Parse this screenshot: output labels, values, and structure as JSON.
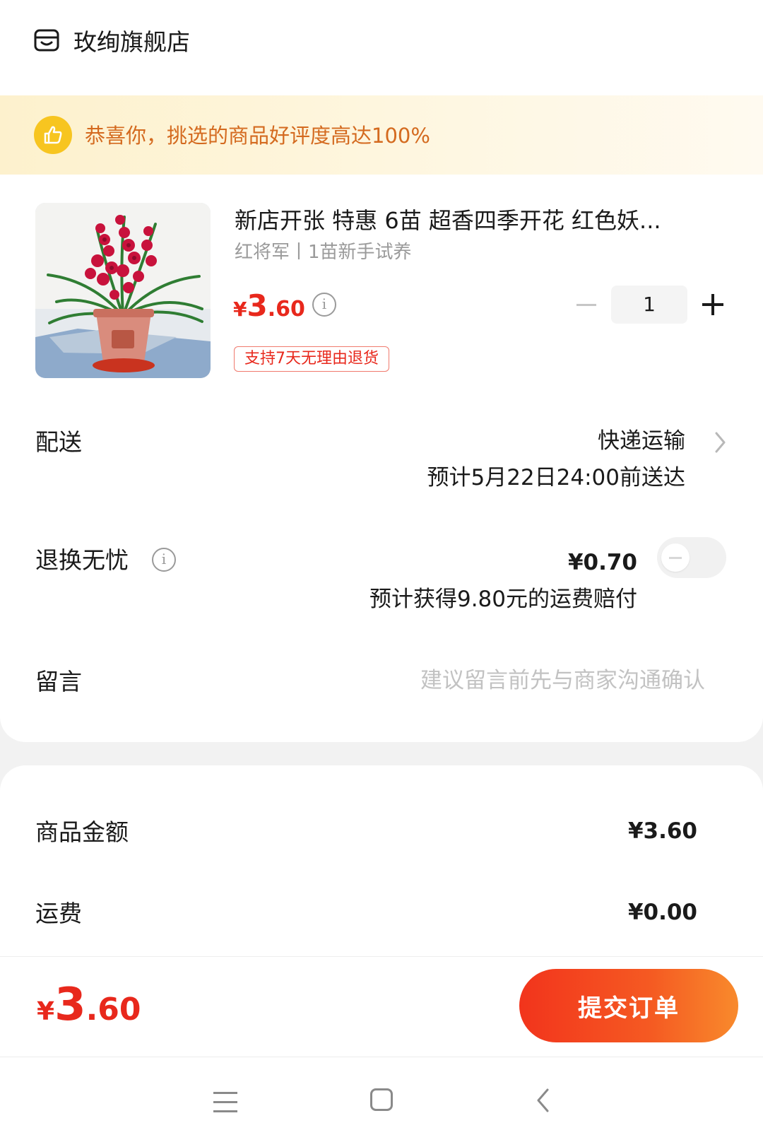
{
  "store": {
    "name": "玫绚旗舰店",
    "icon": "store-icon"
  },
  "banner": {
    "text": "恭喜你，挑选的商品好评度高达100%",
    "icon": "thumbs-up-icon"
  },
  "product": {
    "title": "新店开张 特惠 6苗 超香四季开花 红色妖...",
    "spec": "红将军丨1苗新手试养",
    "price_currency": "¥",
    "price_int": "3",
    "price_dec": ".60",
    "return_badge": "支持7天无理由退货",
    "quantity": "1"
  },
  "shipping": {
    "label": "配送",
    "method": "快递运输",
    "eta": "预计5月22日24:00前送达"
  },
  "worry_free": {
    "label": "退换无忧",
    "price": "¥0.70",
    "note": "预计获得9.80元的运费赔付",
    "enabled": false
  },
  "message": {
    "label": "留言",
    "placeholder": "建议留言前先与商家沟通确认",
    "value": ""
  },
  "summary": {
    "goods_label": "商品金额",
    "goods_value": "¥3.60",
    "shipping_label": "运费",
    "shipping_value": "¥0.00"
  },
  "footer": {
    "total_currency": "¥",
    "total_int": "3",
    "total_dec": ".60",
    "submit_label": "提交订单"
  },
  "colors": {
    "accent_red": "#e8281c",
    "banner_text": "#d46a1f",
    "banner_bg": "#fdf1cd",
    "badge_yellow": "#f7c520"
  }
}
